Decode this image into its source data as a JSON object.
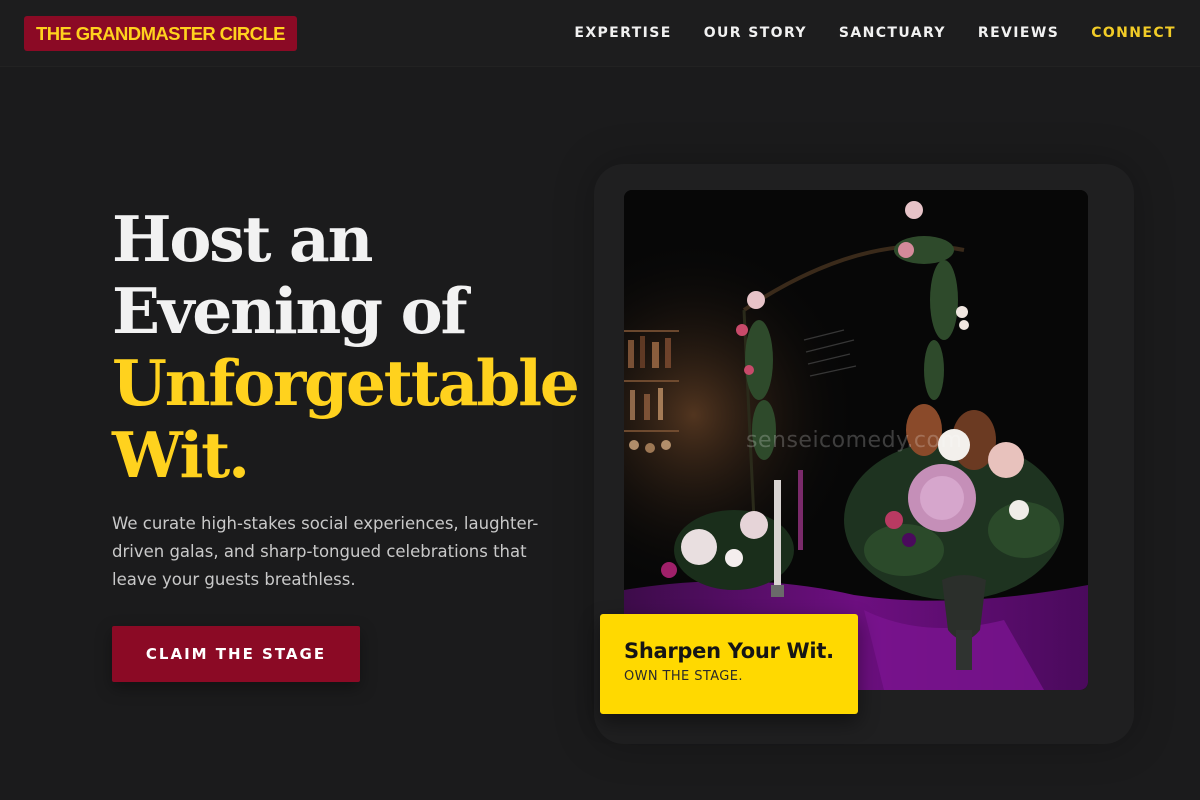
{
  "brand": {
    "name": "THE GRANDMASTER CIRCLE"
  },
  "nav": {
    "items": [
      {
        "label": "EXPERTISE"
      },
      {
        "label": "OUR STORY"
      },
      {
        "label": "SANCTUARY"
      },
      {
        "label": "REVIEWS"
      },
      {
        "label": "CONNECT"
      }
    ]
  },
  "hero": {
    "title_lines": [
      "Host an",
      "Evening of",
      "Unforgettable",
      "Wit."
    ],
    "description": "We curate high-stakes social experiences, laughter-driven galas, and sharp-tongued celebrations that leave your guests breathless.",
    "cta_label": "CLAIM THE STAGE"
  },
  "media": {
    "watermark": "senseicomedy.com"
  },
  "card": {
    "title": "Sharpen Your Wit.",
    "subtitle": "OWN THE STAGE."
  },
  "colors": {
    "background": "#1b1b1c",
    "accent_gold": "#ffd21e",
    "brand_burgundy": "#8b0a25",
    "card_yellow": "#ffd900"
  }
}
